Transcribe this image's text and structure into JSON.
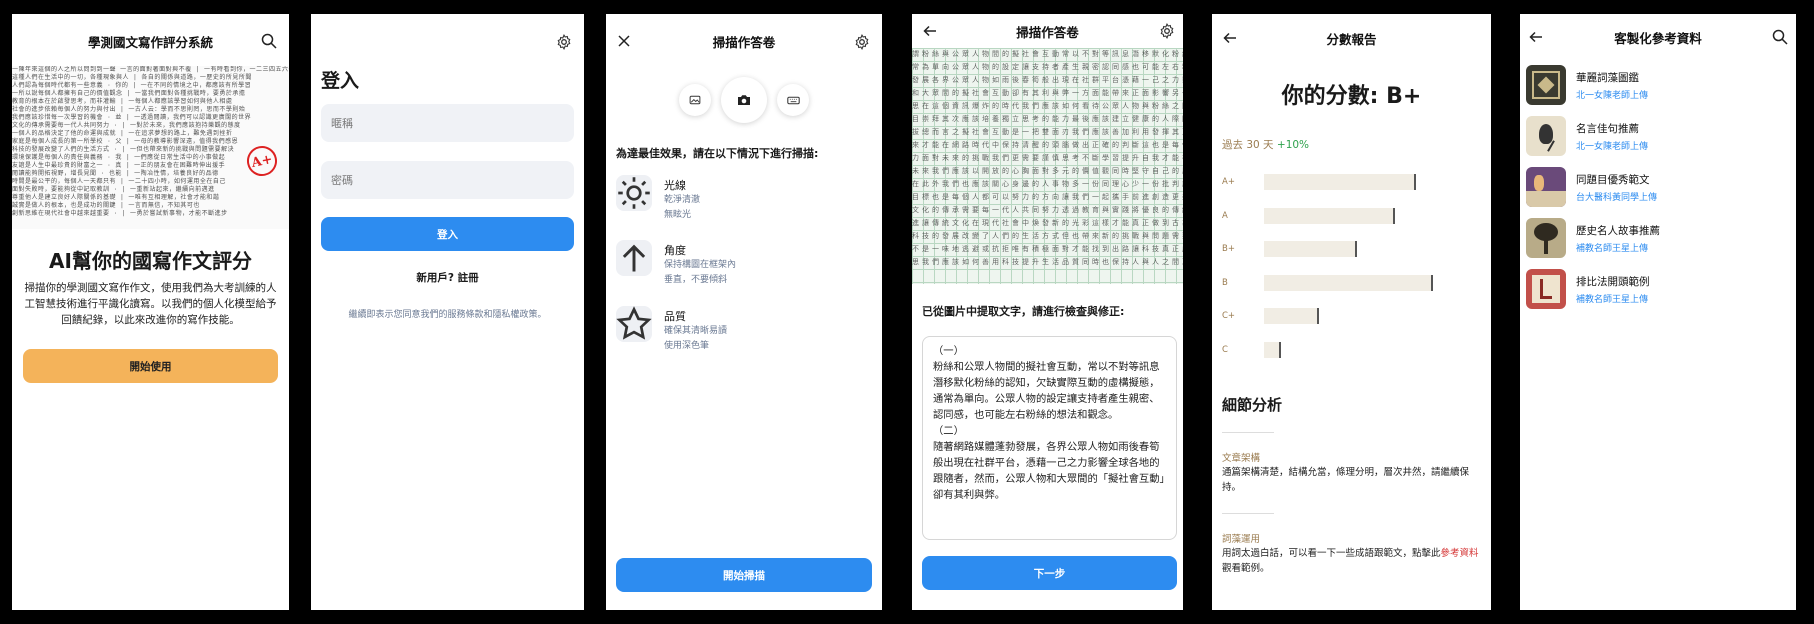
{
  "screen1": {
    "title": "學測國文寫作評分系統",
    "grade_mark": "A+",
    "handwriting_lines": [
      "一陳年來這個的人之所以問到到一聲 一言的面對著面對與不覆 | 一有時看到你，一二三四五六七八九",
      "這種人們在生活中的一切，各種現象與人 | 各自的關係與道路，一歷史的所見所聞",
      "人們認為每個時代都有一些意義 · 你的 | 一在不同的情境之中，都應該有所學習",
      "一所以說每個人都擁有自己的價值觀念 | 一當我們面對各種挑戰時，要勇於承擔",
      "教育的根本在於啟發思考，而非灌輸 | 一每個人都應該學習如何與他人相處",
      "社會的進步依賴每個人的努力與付出 | 一古人云：學而不思則罔，思而不學則殆",
      "我們應該珍惜每一次學習的機會 · 並 | 一透過閱讀，我們可以認識更廣闊的世界",
      "文化的傳承需要每一代人共同努力 · | 一對於未來，我們應該抱持樂觀的態度",
      "一個人的品格決定了他的命運與成就 | 一在追求夢想的路上，難免遇到挫折",
      "家庭是每個人成長的第一所學校 · 父 | 一母的教導影響深遠，值得我們感恩",
      "科技的發展改變了人們的生活方式 · | 一但也帶來新的挑戰與問題需要解決",
      "環境保護是每個人的責任與義務 · 我 | 一們應從日常生活中的小事做起",
      "友誼是人生中最珍貴的財富之一 · 真 | 一正的朋友會在困難時伸出援手",
      "閱讀能夠開拓視野，增長見聞 · 也能 | 一陶冶性情，培養良好的品德",
      "時間是最公平的，每個人一天都只有 | 一二十四小時，如何運用全在自己",
      "面對失敗時，要能夠從中記取教訓 · | 一重新站起來，繼續向前邁進",
      "尊重他人是建立良好人際關係的基礎 | 一唯有互相理解，社會才能和諧",
      "誠實是做人的根本，也是成功的關鍵 | 一言而無信，不知其可也",
      "創新思維在現代社會中越來越重要 · | 一勇於嘗試新事物，才能不斷進步"
    ],
    "headline": "AI幫你的國寫作文評分",
    "description": "掃描你的學測國文寫作作文，使用我們為大考訓練的人工智慧技術進行平識化讀寫。以我們的個人化模型給予回饋紀錄，以此來改進你的寫作技能。",
    "cta": "開始使用"
  },
  "screen2": {
    "title": "登入",
    "username_placeholder": "暱稱",
    "password_placeholder": "密碼",
    "login_button": "登入",
    "new_user": "新用戶? 註冊",
    "terms": "繼續即表示您同意我們的服務條款和隱私權政策。"
  },
  "screen3": {
    "title": "掃描作答卷",
    "hint": "為達最佳效果，請在以下情況下進行掃描:",
    "tips": [
      {
        "icon": "sun-icon",
        "title": "光線",
        "lines": [
          "乾淨清澈",
          "無眩光"
        ]
      },
      {
        "icon": "arrow-up-icon",
        "title": "角度",
        "lines": [
          "保持構圖在框架內",
          "垂直，不要傾斜"
        ]
      },
      {
        "icon": "star-icon",
        "title": "品質",
        "lines": [
          "確保其清晰易讀",
          "使用深色筆"
        ]
      }
    ],
    "start_button": "開始掃描"
  },
  "screen4": {
    "title": "掃描作答卷",
    "scan_lines": [
      "謂粉絲與公眾人物間的擬社會互動常以不對等訊息潛移默化粉絲的認知欠缺實際互動的虛構擬態通",
      "常為單向公眾人物的設定讓支持者產生親密認同感也可能左右粉絲的想法和觀念隨著網路媒體蓬勃",
      "發展各界公眾人物如雨後春筍般出現在社群平台憑藉一己之力影響全球各地的跟隨者然而公眾人物",
      "和大眾間的擬社會互動卻有其利與弊一方面能帶來正面影響另一方面也可能造成負面的後果值得深",
      "思在這個資訊爆炸的時代我們應該如何看待公眾人物與粉絲之間的關係呢首先應該理性看待避免盲",
      "目崇拜其次應該培養獨立思考的能力最後應該建立健康的人際關係以免陷入虛擬的情感之中無法自",
      "拔總而言之擬社會互動是一把雙面刃我們應該善加利用發揮其正面的功能避免其負面的影響如此一",
      "來才能在網路時代中保持清醒的頭腦做出正確的判斷這也是每個現代人都應該具備的媒體素養與能",
      "力面對未來的挑戰我們更需要謹慎思考不斷學習提升自我才能在變動的社會中站穩腳步迎向光明的",
      "未來我們應該以開放的心胸面對多元的價值觀同時堅守自己的原則不隨波逐流這才是真正的智慧所",
      "在此外我們也應該關心身邊的人事物多一份同理心少一份批判讓社會更加和諧美好這是我們共同的",
      "目標也是每個人都可以努力的方向讓我們一起攜手前進創造更美好的明天共同努力為社會貢獻心力",
      "文化的傳承需要每一代人共同努力透過教育與實踐將優良的傳統延續下去同時也要勇於創新與時俱",
      "進讓傳統文化在現代社會中煥發新的光彩這樣才能真正做到古為今用推陳出新的理想境界值得期待",
      "科技的發展改變了人們的生活方式但也帶來新的挑戰與問題需要我們共同面對並尋求解決的方法而",
      "不是一味地逃避或抗拒唯有積極面對才能找到出路讓科技真正成為人類進步的助力而非阻力值得省",
      "思我們應該如何善用科技提升生活品質同時也保持人與人之間真誠的互動這是現代人必修的課題呀"
    ],
    "extract_label": "已從圖片中提取文字，請進行檢查與修正:",
    "extracted_text": "（一）\n粉絲和公眾人物間的擬社會互動，常以不對等訊息潛移默化粉絲的認知，欠缺實際互動的虛構擬態，通常為單向。公眾人物的設定讓支持者產生親密、認同感，也可能左右粉絲的想法和觀念。\n（二）\n隨著網路媒體蓬勃發展，各界公眾人物如雨後春筍般出現在社群平台，憑藉一己之力影響全球各地的跟隨者，然而，公眾人物和大眾間的「擬社會互動」卻有其利與弊。",
    "next_button": "下一步"
  },
  "screen5": {
    "title": "分數報告",
    "score": "你的分數: B+",
    "period": "過去 30 天",
    "change": "+10%",
    "accent_color": "#9a7b4f",
    "grade_bars": [
      {
        "label": "A+",
        "value": 0.8
      },
      {
        "label": "A",
        "value": 0.69
      },
      {
        "label": "B+",
        "value": 0.49
      },
      {
        "label": "B",
        "value": 0.89
      },
      {
        "label": "C+",
        "value": 0.29
      },
      {
        "label": "C",
        "value": 0.09
      }
    ],
    "section_title": "細節分析",
    "details": [
      {
        "heading": "文章架構",
        "text": "通篇架構清楚，結構允當，條理分明，層次井然，請繼續保持。"
      },
      {
        "heading": "詞藻運用",
        "text_before": "用詞太過白話，可以看一下一些成語跟範文，點擊此",
        "link": "參考資料",
        "text_after": "觀看範例。"
      }
    ]
  },
  "screen6": {
    "title": "客製化參考資料",
    "items": [
      {
        "title": "華麗詞藻圖鑑",
        "subtitle": "北一女陳老師上傳"
      },
      {
        "title": "名言佳句推薦",
        "subtitle": "北一女陳老師上傳"
      },
      {
        "title": "同題目優秀範文",
        "subtitle": "台大醫科黃同學上傳"
      },
      {
        "title": "歷史名人故事推薦",
        "subtitle": "補教名師王星上傳"
      },
      {
        "title": "排比法開頭範例",
        "subtitle": "補教名師王星上傳"
      }
    ]
  },
  "colors": {
    "primary_blue": "#2d8cf0",
    "cta_orange": "#f4b35a",
    "link_red": "#d63a3a",
    "positive_green": "#2fa24d"
  }
}
